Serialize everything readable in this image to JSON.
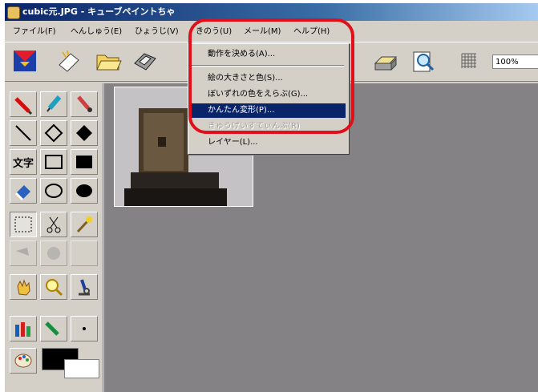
{
  "window": {
    "title": "cubic元.JPG - キューブペイントちゃ"
  },
  "menubar": {
    "items": [
      {
        "label": "ファイル(F)"
      },
      {
        "label": "へんしゅう(E)"
      },
      {
        "label": "ひょうじ(V)"
      },
      {
        "label": "きのう(U)"
      },
      {
        "label": "メール(M)"
      },
      {
        "label": "ヘルプ(H)"
      }
    ]
  },
  "toolbar": {
    "zoom": "100%"
  },
  "dropdown": {
    "items": [
      {
        "label": "動作を決める(A)..."
      },
      {
        "label": "絵の大きさと色(S)..."
      },
      {
        "label": "ぼいずれの色をえらぶ(G)..."
      },
      {
        "label": "かんたん変形(P)..."
      },
      {
        "label": "きゅうげいすてぃんぷ(R)"
      },
      {
        "label": "レイヤー(L)..."
      }
    ]
  },
  "toolbox": {
    "text_tool": "文字"
  },
  "colors": {
    "accent": "#e0101a",
    "selection": "#0a246a",
    "workspace": "#848284"
  }
}
